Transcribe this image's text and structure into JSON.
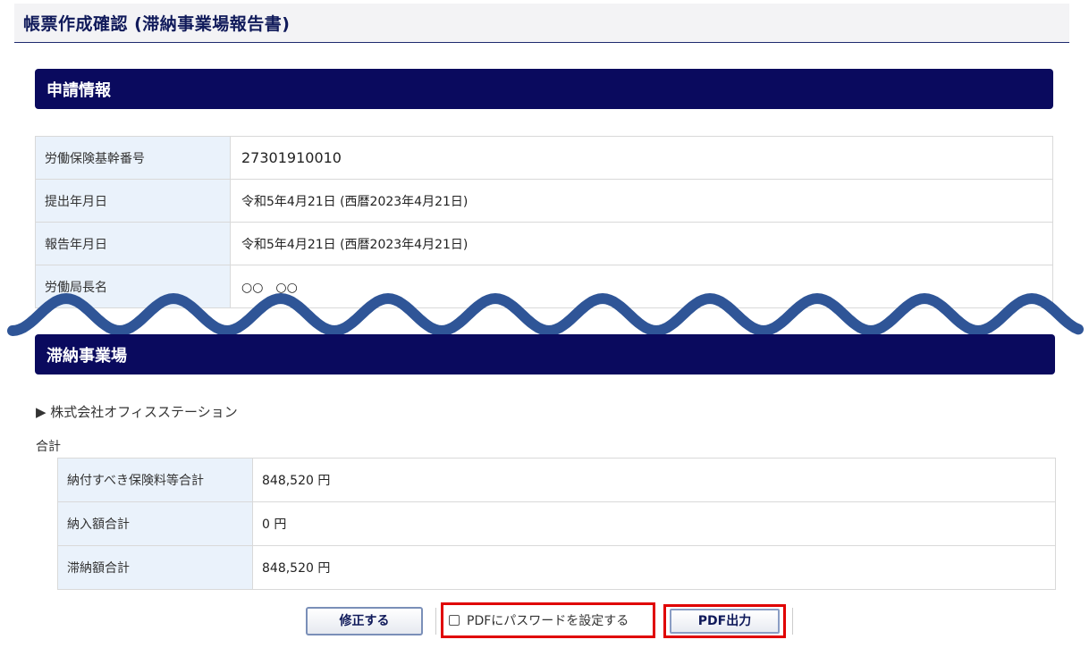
{
  "page": {
    "title": "帳票作成確認 (滞納事業場報告書)"
  },
  "sections": {
    "application_info": "申請情報",
    "delinquent": "滞納事業場"
  },
  "application_info": {
    "rows": [
      {
        "label": "労働保険基幹番号",
        "value": "27301910010"
      },
      {
        "label": "提出年月日",
        "value": "令和5年4月21日 (西暦2023年4月21日)"
      },
      {
        "label": "報告年月日",
        "value": "令和5年4月21日 (西暦2023年4月21日)"
      },
      {
        "label": "労働局長名",
        "value": "○○　○○"
      }
    ]
  },
  "delinquent": {
    "company": "▶ 株式会社オフィスステーション",
    "total_label": "合計",
    "rows": [
      {
        "label": "納付すべき保険料等合計",
        "value": "848,520 円"
      },
      {
        "label": "納入額合計",
        "value": "0 円"
      },
      {
        "label": "滞納額合計",
        "value": "848,520 円"
      }
    ]
  },
  "footer": {
    "fix_button": "修正する",
    "pdf_password_label": "PDFにパスワードを設定する",
    "pdf_button": "PDF出力"
  },
  "colors": {
    "section_bar": "#0a0a5e",
    "label_bg": "#eaf2fb",
    "highlight": "#e00000",
    "wave": "#2f5597"
  }
}
